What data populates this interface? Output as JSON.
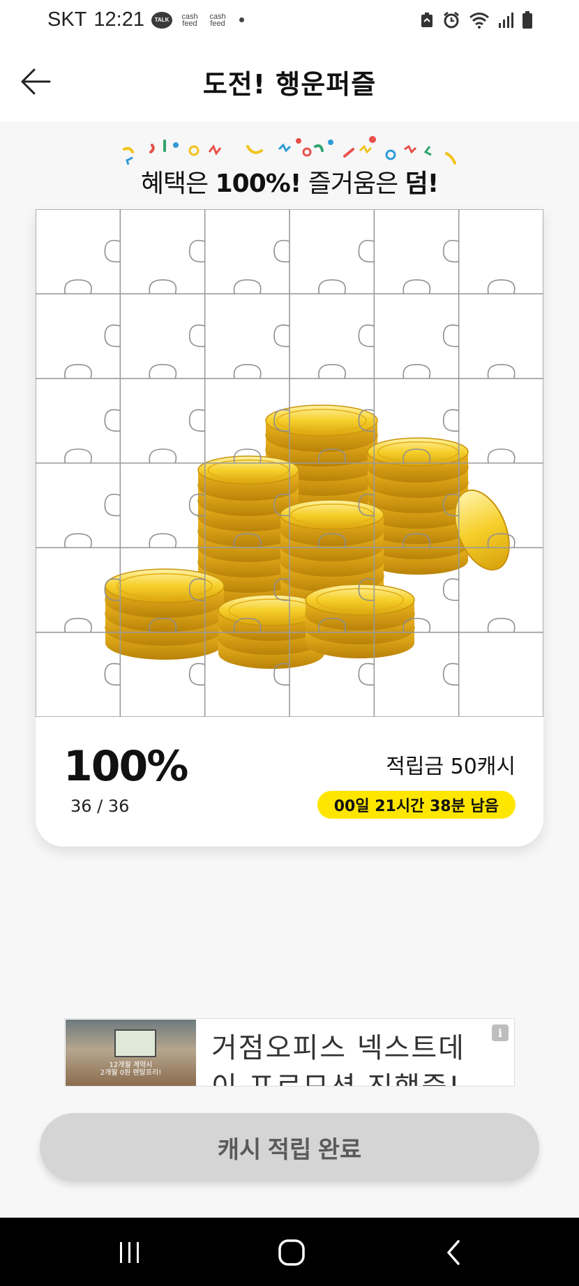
{
  "status_bar": {
    "carrier": "SKT",
    "time": "12:21",
    "talk_badge": "TALK",
    "cashfeed_1": "cash feed",
    "cashfeed_2": "cash feed",
    "icons": [
      "recycle-icon",
      "alarm-icon",
      "wifi-icon",
      "signal-icon",
      "battery-icon"
    ]
  },
  "header": {
    "title": "도전! 행운퍼즐",
    "back_icon": "back-arrow-icon"
  },
  "banner": {
    "prefix": "혜택은 ",
    "bold_1": "100%!",
    "middle": " 즐거움은 ",
    "bold_2": "덤!"
  },
  "puzzle": {
    "rows": 6,
    "cols": 6,
    "image": "gold-coins"
  },
  "progress": {
    "percent": "100%",
    "count": "36 / 36",
    "reward": "적립금 50캐시",
    "time_left": "00일 21시간 38분 남음"
  },
  "ad": {
    "headline": "거점오피스 넥스트데이 프로모션 진행중!",
    "image_caption_1": "12개월 계약시",
    "image_caption_2": "2개월 0원 렌탈프리!",
    "info_icon": "i"
  },
  "button": {
    "label": "캐시 적립 완료"
  },
  "colors": {
    "accent_yellow": "#ffe600",
    "button_gray": "#d5d5d5",
    "coin_gold": "#f2c21b"
  }
}
